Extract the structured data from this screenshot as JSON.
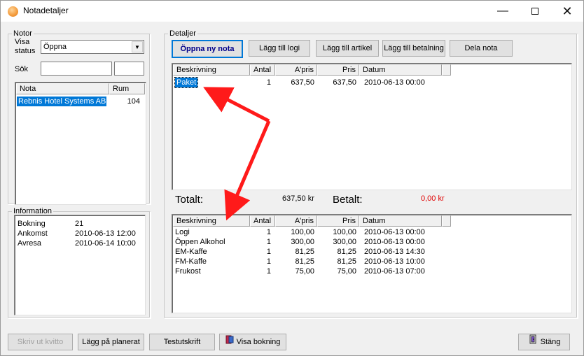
{
  "window": {
    "title": "Notadetaljer"
  },
  "notor": {
    "legend": "Notor",
    "visa_status_label_1": "Visa",
    "visa_status_label_2": "status",
    "visa_status_value": "Öppna",
    "sok_label": "Sök",
    "sok_value": "",
    "list": {
      "headers": [
        "Nota",
        "Rum"
      ],
      "rows": [
        {
          "nota": "Rebnis Hotel Systems AB",
          "rum": "104"
        }
      ]
    }
  },
  "information": {
    "legend": "Information",
    "rows": [
      {
        "label": "Bokning",
        "value": "21"
      },
      {
        "label": "Ankomst",
        "value": "2010-06-13 12:00"
      },
      {
        "label": "Avresa",
        "value": "2010-06-14 10:00"
      }
    ]
  },
  "detaljer": {
    "legend": "Detaljer",
    "buttons": {
      "oppna": "Öppna ny nota",
      "logi": "Lägg till logi",
      "artikel": "Lägg till artikel",
      "betalning": "Lägg till betalning",
      "dela": "Dela nota"
    },
    "columns": [
      "Beskrivning",
      "Antal",
      "A'pris",
      "Pris",
      "Datum"
    ],
    "top_rows": [
      {
        "beskrivning": "Paket",
        "antal": "1",
        "apris": "637,50",
        "pris": "637,50",
        "datum": "2010-06-13 00:00"
      }
    ],
    "totals": {
      "totalt_label": "Totalt:",
      "totalt_value": "637,50 kr",
      "betalt_label": "Betalt:",
      "betalt_value": "0,00 kr"
    },
    "bottom_rows": [
      {
        "beskrivning": "Logi",
        "antal": "1",
        "apris": "100,00",
        "pris": "100,00",
        "datum": "2010-06-13 00:00"
      },
      {
        "beskrivning": "Öppen Alkohol",
        "antal": "1",
        "apris": "300,00",
        "pris": "300,00",
        "datum": "2010-06-13 00:00"
      },
      {
        "beskrivning": "EM-Kaffe",
        "antal": "1",
        "apris": "81,25",
        "pris": "81,25",
        "datum": "2010-06-13 14:30"
      },
      {
        "beskrivning": "FM-Kaffe",
        "antal": "1",
        "apris": "81,25",
        "pris": "81,25",
        "datum": "2010-06-13 10:00"
      },
      {
        "beskrivning": "Frukost",
        "antal": "1",
        "apris": "75,00",
        "pris": "75,00",
        "datum": "2010-06-13 07:00"
      }
    ]
  },
  "footer": {
    "skriv_ut": "Skriv ut kvitto",
    "lagg_pa": "Lägg på planerat",
    "testutskrift": "Testutskrift",
    "visa_bokning": "Visa bokning",
    "stang": "Stäng"
  },
  "colors": {
    "selection": "#0078d7",
    "annotation_arrow": "#ff1a1a",
    "betalt": "#e00000"
  }
}
